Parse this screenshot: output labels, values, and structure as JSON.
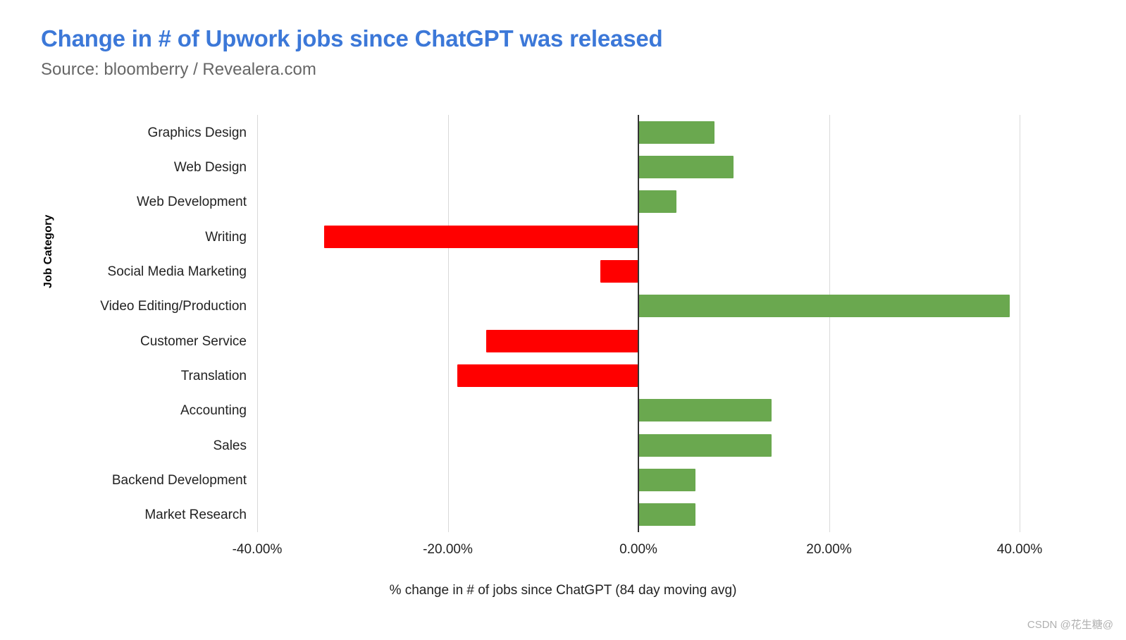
{
  "header": {
    "title": "Change in # of Upwork jobs since ChatGPT was released",
    "subtitle": "Source: bloomberry / Revealera.com",
    "title_color": "#3c78d8",
    "subtitle_color": "#666666"
  },
  "watermark": {
    "text": "CSDN @花生糖@"
  },
  "chart_data": {
    "type": "bar",
    "orientation": "horizontal",
    "title": "Change in # of Upwork jobs since ChatGPT was released",
    "subtitle": "Source: bloomberry / Revealera.com",
    "xlabel": "% change in # of jobs since ChatGPT (84 day moving avg)",
    "ylabel": "Job Category",
    "xlim": [
      -50,
      45
    ],
    "xticks": [
      -40,
      -20,
      0,
      20,
      40
    ],
    "xtick_labels": [
      "-40.00%",
      "-20.00%",
      "0.00%",
      "20.00%",
      "40.00%"
    ],
    "grid": true,
    "legend": "none",
    "positive_color": "#6aa84f",
    "negative_color": "#ff0000",
    "categories": [
      "Graphics Design",
      "Web Design",
      "Web Development",
      "Writing",
      "Social Media Marketing",
      "Video Editing/Production",
      "Customer Service",
      "Translation",
      "Accounting",
      "Sales",
      "Backend Development",
      "Market Research"
    ],
    "values": [
      8.0,
      10.0,
      4.0,
      -33.0,
      -4.0,
      39.0,
      -16.0,
      -19.0,
      14.0,
      14.0,
      6.0,
      6.0
    ]
  }
}
